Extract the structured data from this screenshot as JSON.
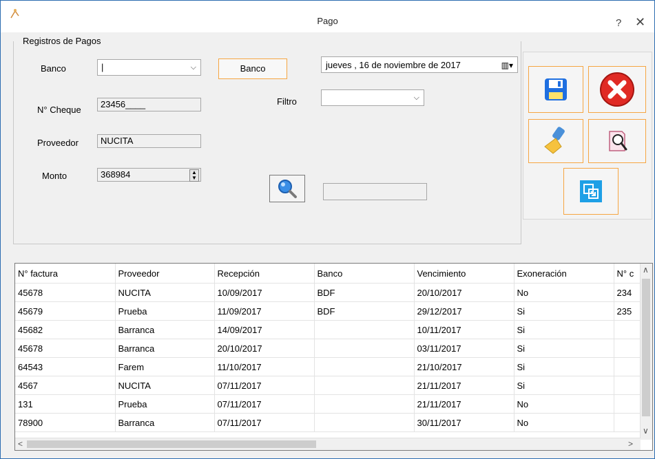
{
  "window": {
    "title": "Pago",
    "help": "?",
    "close": "✕"
  },
  "group": {
    "title": "Registros de Pagos"
  },
  "form": {
    "banco_label": "Banco",
    "banco_value": "|",
    "banco_button": "Banco",
    "cheque_label": "N° Cheque",
    "cheque_value": "23456____",
    "proveedor_label": "Proveedor",
    "proveedor_value": "NUCITA",
    "monto_label": "Monto",
    "monto_value": "368984",
    "filtro_label": "Filtro",
    "filtro_value": "",
    "search_value": "",
    "date_value": "jueves  , 16 de noviembre de 2017"
  },
  "tools": [
    "save-icon",
    "cancel-icon",
    "clear-brush-icon",
    "preview-search-icon",
    "export-icon"
  ],
  "table": {
    "columns": [
      "N° factura",
      "Proveedor",
      "Recepción",
      "Banco",
      "Vencimiento",
      "Exoneración",
      "N° c"
    ],
    "rows": [
      [
        "45678",
        "NUCITA",
        "10/09/2017",
        "BDF",
        "20/10/2017",
        "No",
        "234"
      ],
      [
        "45679",
        "Prueba",
        "11/09/2017",
        "BDF",
        "29/12/2017",
        "Si",
        "235"
      ],
      [
        "45682",
        "Barranca",
        "14/09/2017",
        "",
        "10/11/2017",
        "Si",
        ""
      ],
      [
        "45678",
        "Barranca",
        "20/10/2017",
        "",
        "03/11/2017",
        "Si",
        ""
      ],
      [
        "64543",
        "Farem",
        "11/10/2017",
        "",
        "21/10/2017",
        "Si",
        ""
      ],
      [
        "4567",
        "NUCITA",
        "07/11/2017",
        "",
        "21/11/2017",
        "Si",
        ""
      ],
      [
        "131",
        "Prueba",
        "07/11/2017",
        "",
        "21/11/2017",
        "No",
        ""
      ],
      [
        "78900",
        "Barranca",
        "07/11/2017",
        "",
        "30/11/2017",
        "No",
        ""
      ]
    ]
  },
  "colors": {
    "accent_border": "#f6a541",
    "window_border": "#2b6cb0",
    "save_blue": "#1f6fe0",
    "cancel_red": "#e02a24"
  }
}
